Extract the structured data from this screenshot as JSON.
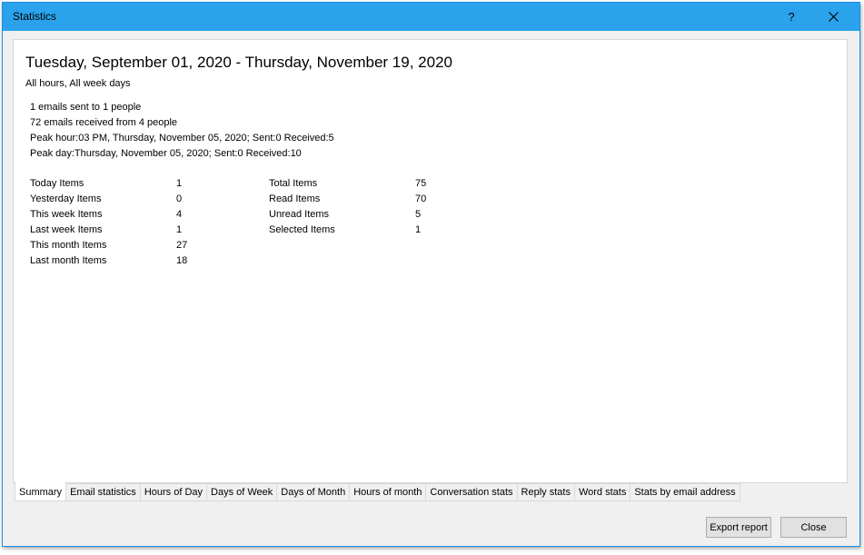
{
  "window": {
    "title": "Statistics",
    "help_glyph": "?"
  },
  "report": {
    "heading": "Tuesday, September 01, 2020 - Thursday, November 19, 2020",
    "subheading": "All hours, All week days",
    "summary_lines": [
      "1 emails sent to 1 people",
      "72 emails received from 4 people",
      "Peak hour:03 PM, Thursday, November 05, 2020; Sent:0 Received:5",
      "Peak day:Thursday, November 05, 2020; Sent:0 Received:10"
    ],
    "left_stats": [
      {
        "label": "Today Items",
        "value": "1"
      },
      {
        "label": "Yesterday Items",
        "value": "0"
      },
      {
        "label": "This week Items",
        "value": "4"
      },
      {
        "label": "Last week Items",
        "value": "1"
      },
      {
        "label": "This month Items",
        "value": "27"
      },
      {
        "label": "Last month Items",
        "value": "18"
      }
    ],
    "right_stats": [
      {
        "label": "Total Items",
        "value": "75"
      },
      {
        "label": "Read Items",
        "value": "70"
      },
      {
        "label": "Unread Items",
        "value": "5"
      },
      {
        "label": "Selected Items",
        "value": "1"
      }
    ]
  },
  "tabs": [
    {
      "label": "Summary",
      "active": true
    },
    {
      "label": "Email statistics",
      "active": false
    },
    {
      "label": "Hours of Day",
      "active": false
    },
    {
      "label": "Days of Week",
      "active": false
    },
    {
      "label": "Days of Month",
      "active": false
    },
    {
      "label": "Hours of month",
      "active": false
    },
    {
      "label": "Conversation stats",
      "active": false
    },
    {
      "label": "Reply stats",
      "active": false
    },
    {
      "label": "Word stats",
      "active": false
    },
    {
      "label": "Stats by email address",
      "active": false
    }
  ],
  "buttons": {
    "export_label": "Export report",
    "close_label": "Close"
  },
  "colors": {
    "titlebar": "#2aa3ec",
    "window_bg": "#f0f0f0",
    "panel_bg": "#ffffff"
  }
}
